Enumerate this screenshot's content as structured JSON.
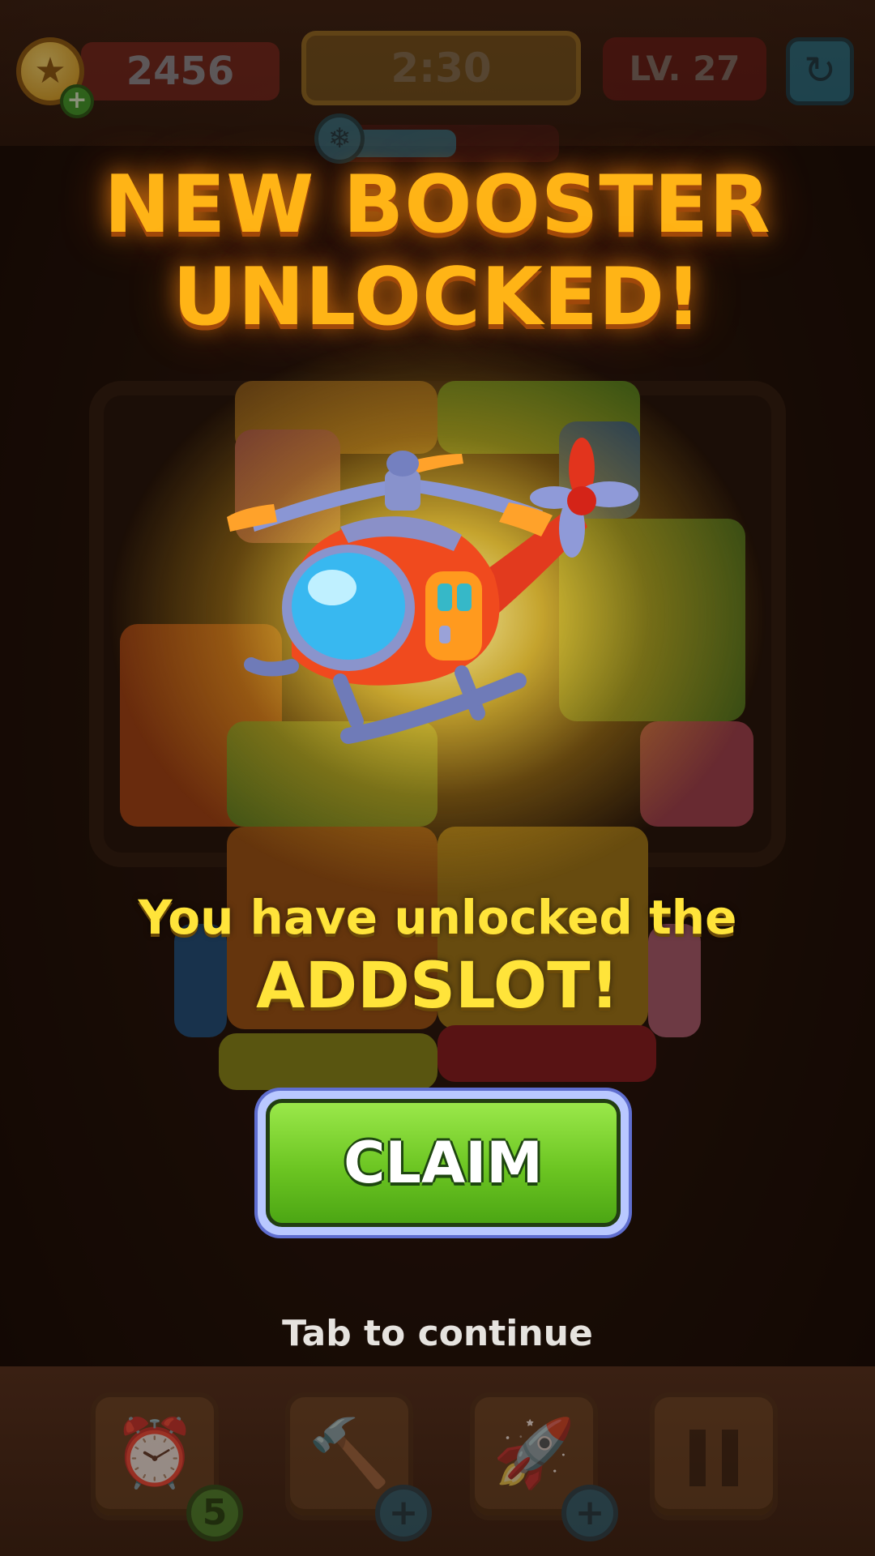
{
  "hud": {
    "coins": "2456",
    "timer": "2:30",
    "level": "LV. 27",
    "freeze_progress": 0.55
  },
  "popup": {
    "title_line1": "NEW BOOSTER",
    "title_line2": "UNLOCKED!",
    "message_line1": "You have unlocked the",
    "message_line2": "ADDSLOT!",
    "claim_label": "CLAIM",
    "continue_label": "Tab to continue"
  },
  "boosters": [
    {
      "icon": "alarm-clock-icon",
      "badge": "5"
    },
    {
      "icon": "hammer-icon",
      "badge": "+"
    },
    {
      "icon": "firework-rocket-icon",
      "badge": "+"
    },
    {
      "icon": "pause-icon"
    }
  ],
  "colors": {
    "title": "#ffb416",
    "message": "#ffe43a",
    "claim_button": "#6cc522"
  }
}
